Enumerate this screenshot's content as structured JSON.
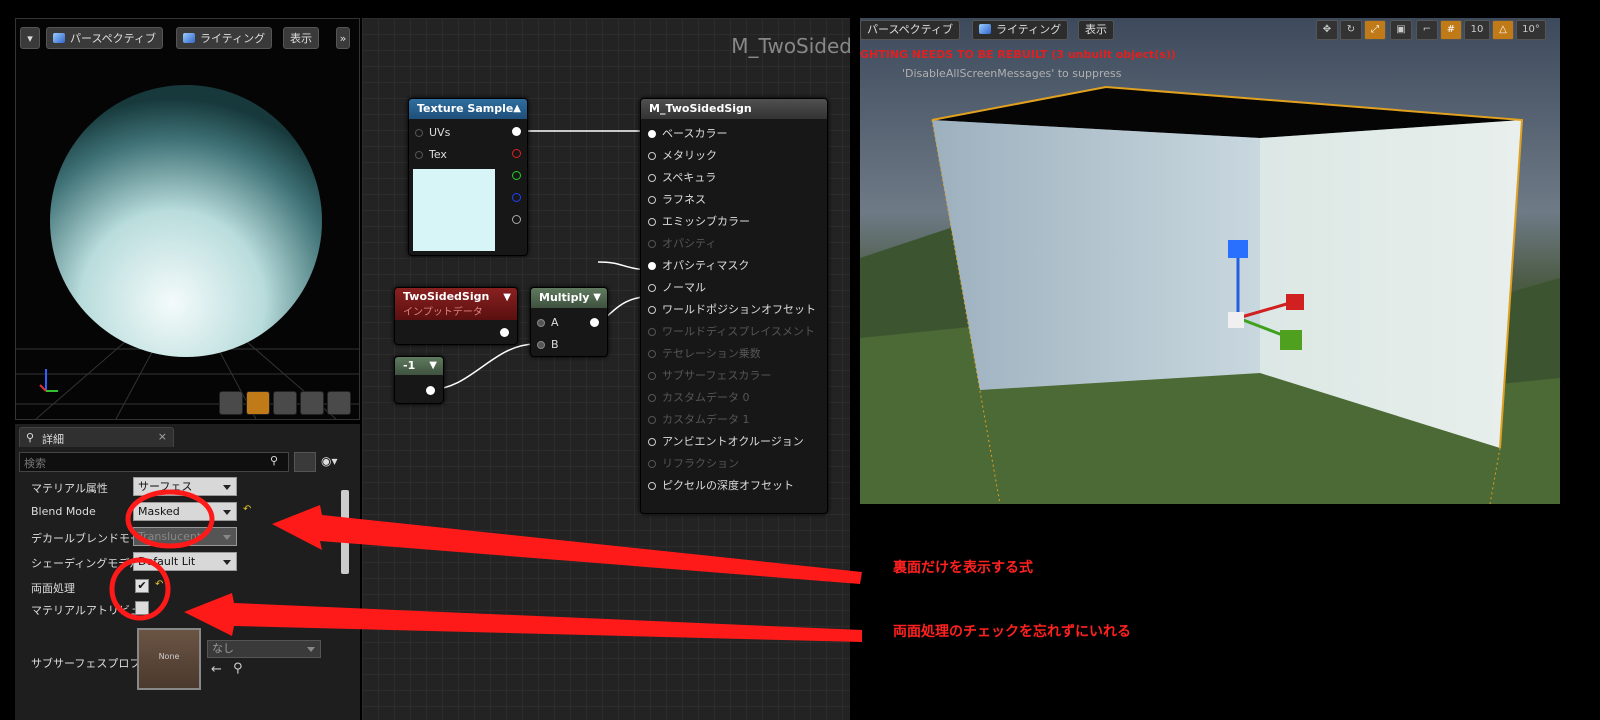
{
  "left_viewport": {
    "perspective_label": "パースペクティブ",
    "lighting_label": "ライティング",
    "show_label": "表示",
    "expand_glyph": "»"
  },
  "details": {
    "tab_label": "詳細",
    "tab_close": "×",
    "search_placeholder": "検索",
    "props": [
      {
        "label": "マテリアル属性",
        "value": "サーフェス"
      },
      {
        "label": "Blend Mode",
        "value": "Masked"
      },
      {
        "label": "デカールブレンドモード",
        "value": "Translucent"
      },
      {
        "label": "シェーディングモデル",
        "value": "Default Lit"
      },
      {
        "label": "両面処理",
        "value": "✔"
      },
      {
        "label": "マテリアルアトリビュート"
      },
      {
        "label": "サブサーフェスプロファイル"
      }
    ],
    "asset_thumb_label": "None",
    "asset_value": "なし"
  },
  "graph": {
    "title": "M_TwoSided",
    "texture_sample": {
      "title": "Texture Sample",
      "pins": [
        "UVs",
        "Tex"
      ]
    },
    "param": {
      "title": "TwoSidedSign",
      "subtitle": "インプットデータ"
    },
    "multiply": {
      "title": "Multiply",
      "pins": [
        "A",
        "B"
      ]
    },
    "const": {
      "title": "-1"
    },
    "material": {
      "title": "M_TwoSidedSign",
      "pins": [
        "ベースカラー",
        "メタリック",
        "スペキュラ",
        "ラフネス",
        "エミッシブカラー",
        "オパシティ",
        "オパシティマスク",
        "ノーマル",
        "ワールドポジションオフセット",
        "ワールドディスプレイスメント",
        "テセレーション乗数",
        "サブサーフェスカラー",
        "カスタムデータ 0",
        "カスタムデータ 1",
        "アンビエントオクルージョン",
        "リフラクション",
        "ピクセルの深度オフセット"
      ]
    }
  },
  "right_viewport": {
    "perspective_label": "パースペクティブ",
    "lighting_label": "ライティング",
    "show_label": "表示",
    "grid_snap": "10",
    "angle_snap": "10°",
    "warning": "GHTING NEEDS TO BE REBUILT (3 unbuilt object(s))",
    "suppress": "'DisableAllScreenMessages' to suppress"
  },
  "annotations": {
    "note1": "裏面だけを表示する式",
    "note2": "両面処理のチェックを忘れずにいれる"
  },
  "colors": {
    "annotation": "#ff2020",
    "param_header": "#7a1a1a",
    "texture_header": "#1f4f7a",
    "multiply_header": "#4a5f4a"
  }
}
